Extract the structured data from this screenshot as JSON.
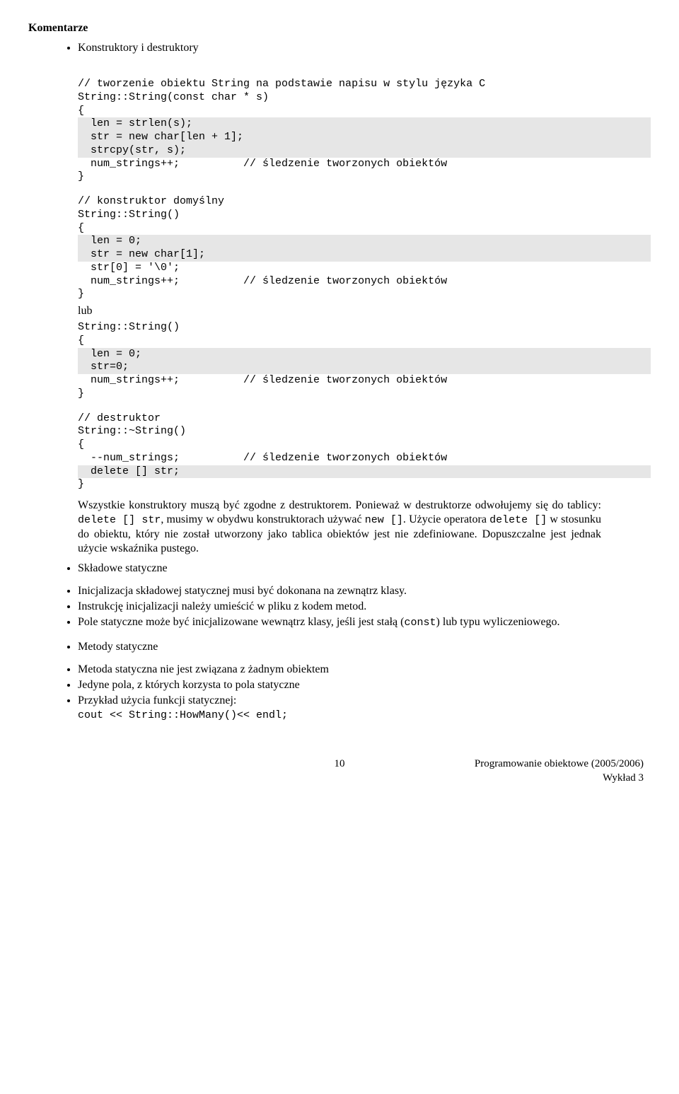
{
  "heading": "Komentarze",
  "bullet1": "Konstruktory i destruktory",
  "code": {
    "c1_comment": "// tworzenie obiektu String na podstawie napisu w stylu języka C",
    "c1_l1": "String::String(const char * s)",
    "c1_l2": "{",
    "c1_l3a": "  len = strlen(s);",
    "c1_l3b": "  str = new char[len + 1];",
    "c1_l3c": "  strcpy(str, s);",
    "c1_l4a": "  num_strings++;",
    "c1_l4b": "          // śledzenie tworzonych obiektów",
    "c1_l5": "}",
    "c2_comment": "// konstruktor domyślny",
    "c2_l1": "String::String()",
    "c2_l2": "{",
    "c2_l3a": "  len = 0;",
    "c2_l3b": "  str = new char[1];",
    "c2_l4a": "  str[0] = '\\0';",
    "c2_l5a": "  num_strings++;",
    "c2_l5b": "          // śledzenie tworzonych obiektów",
    "c2_l6": "}",
    "lub": "lub",
    "c3_l1": "String::String()",
    "c3_l2": "{",
    "c3_l3a": "  len = 0;",
    "c3_l3b": "  str=0;",
    "c3_l4a": "  num_strings++;",
    "c3_l4b": "          // śledzenie tworzonych obiektów",
    "c3_l5": "}",
    "c4_comment": "// destruktor",
    "c4_l1": "String::~String()",
    "c4_l2": "{",
    "c4_l3a": "  --num_strings;",
    "c4_l3b": "          // śledzenie tworzonych obiektów",
    "c4_l4": "  delete [] str;",
    "c4_l5": "}"
  },
  "para": {
    "p1a": "Wszystkie konstruktory muszą być zgodne z destruktorem. Ponieważ w destruktorze odwołujemy się do tablicy: ",
    "p1b": "delete [] str",
    "p1c": ", musimy w obydwu konstruktorach używać ",
    "p1d": "new []",
    "p1e": ". Użycie operatora ",
    "p1f": "delete []",
    "p1g": " w stosunku do obiektu, który nie został utworzony jako tablica obiektów jest nie zdefiniowane. Dopuszczalne jest jednak użycie wskaźnika pustego."
  },
  "list2": {
    "head": "Składowe statyczne",
    "i1": "Inicjalizacja składowej statycznej musi być dokonana na zewnątrz klasy.",
    "i2": "Instrukcję inicjalizacji należy umieścić w pliku z kodem metod.",
    "i3a": "Pole statyczne może być inicjalizowane wewnątrz klasy, jeśli jest stałą (",
    "i3b": "const",
    "i3c": ") lub typu wyliczeniowego."
  },
  "list3": {
    "head": "Metody statyczne",
    "i1": "Metoda statyczna nie jest związana z żadnym obiektem",
    "i2": "Jedyne pola, z których korzysta to pola statyczne",
    "i3": "Przykład użycia funkcji statycznej:",
    "code": "cout << String::HowMany()<< endl;"
  },
  "footer": {
    "page": "10",
    "line1": "Programowanie obiektowe (2005/2006)",
    "line2": "Wykład 3"
  }
}
